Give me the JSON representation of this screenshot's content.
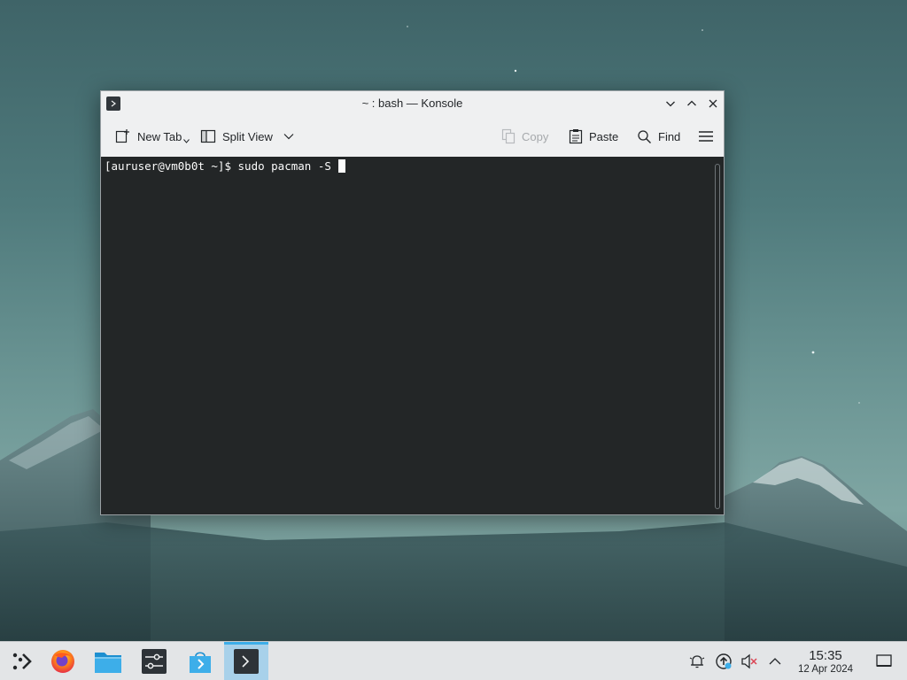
{
  "window": {
    "title": "~ : bash — Konsole"
  },
  "toolbar": {
    "new_tab_label": "New Tab",
    "split_view_label": "Split View",
    "copy_label": "Copy",
    "paste_label": "Paste",
    "find_label": "Find"
  },
  "terminal": {
    "prompt": "[auruser@vm0b0t ~]$ ",
    "command": "sudo pacman -S "
  },
  "taskbar": {
    "apps": [
      {
        "name": "Application Launcher",
        "icon": "kde-launcher-icon"
      },
      {
        "name": "Firefox",
        "icon": "firefox-icon"
      },
      {
        "name": "Dolphin",
        "icon": "folder-icon"
      },
      {
        "name": "System Settings",
        "icon": "settings-icon"
      },
      {
        "name": "Discover",
        "icon": "store-icon"
      },
      {
        "name": "Konsole",
        "icon": "terminal-icon",
        "active": true
      }
    ],
    "tray_icons": [
      "notifications-icon",
      "update-icon",
      "volume-muted-icon",
      "chevron-up-icon"
    ],
    "clock_time": "15:35",
    "clock_date": "12 Apr 2024"
  },
  "colors": {
    "accent": "#3daee9",
    "terminal_bg": "#232627",
    "terminal_fg": "#fcfcfc",
    "taskbar_bg": "#e3e5e7",
    "window_bg": "#eff0f1"
  }
}
